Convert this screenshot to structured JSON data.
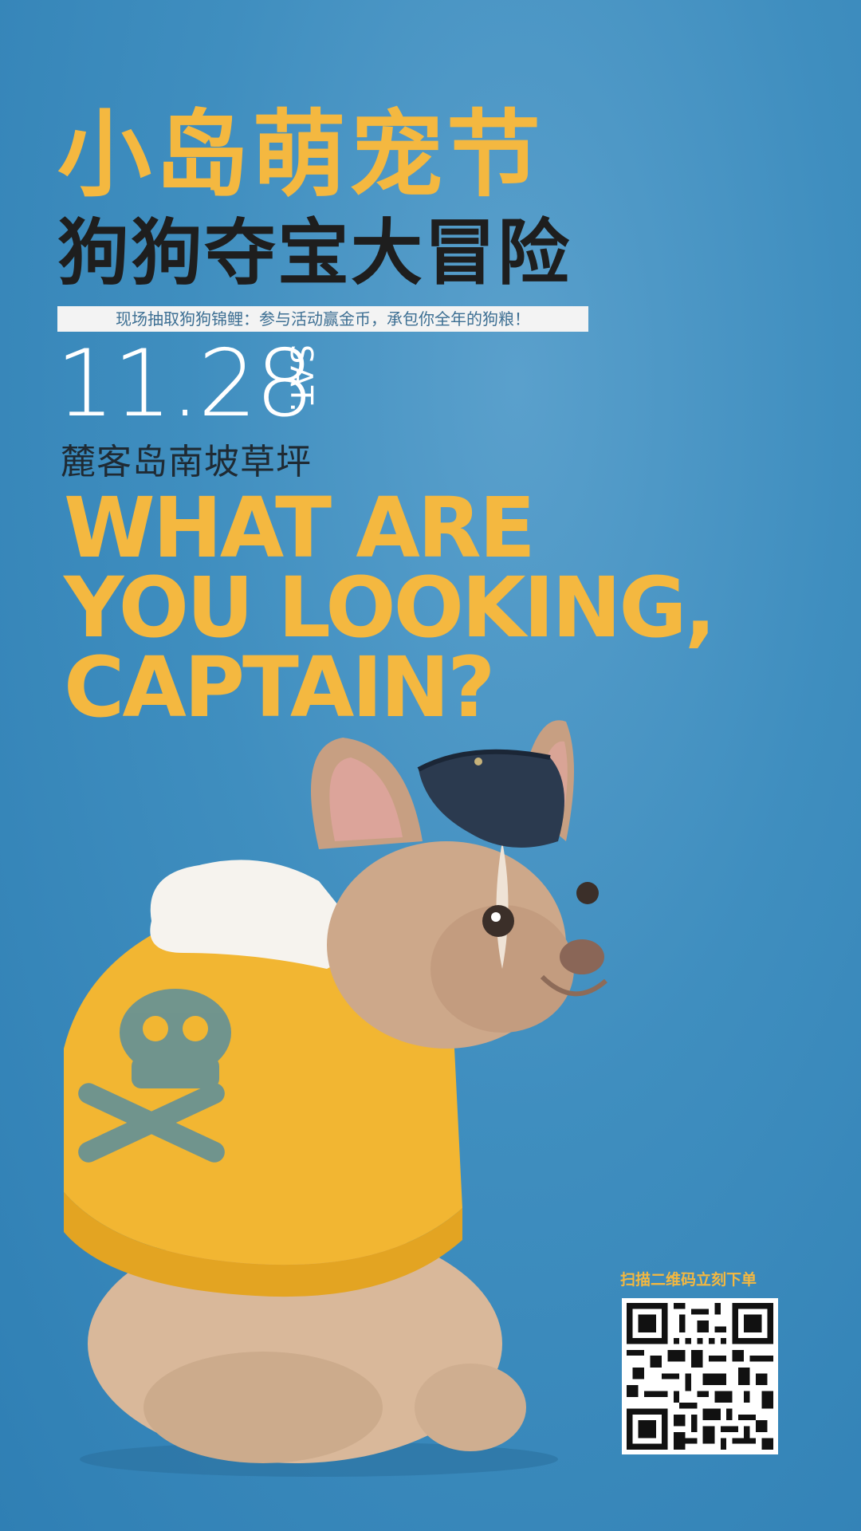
{
  "poster": {
    "title": "小岛萌宠节",
    "subtitle": "狗狗夺宝大冒险",
    "tagline": "现场抽取狗狗锦鲤：参与活动赢金币，承包你全年的狗粮！",
    "date": "11.28",
    "weekday": "SAT.",
    "venue": "麓客岛南坡草坪",
    "headline": [
      "WHAT ARE",
      "YOU LOOKING,",
      "CAPTAIN?"
    ],
    "qr_caption": "扫描二维码立刻下单"
  },
  "colors": {
    "background": "#3f8ebf",
    "accent_yellow": "#f4b840",
    "dark_text": "#1e1e1e",
    "white": "#ffffff"
  },
  "icons": {
    "dog_photo": "french-bulldog-in-pirate-hat-and-yellow-hoodie",
    "qr_code": "qr-code"
  }
}
